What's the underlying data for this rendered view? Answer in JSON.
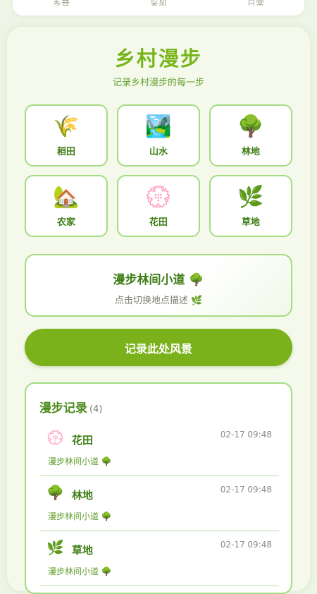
{
  "top_nav": {
    "items": [
      "乡音",
      "采风",
      "日常"
    ]
  },
  "header": {
    "title": "乡村漫步",
    "subtitle": "记录乡村漫步的每一步"
  },
  "places": [
    {
      "label": "稻田",
      "icon": "🌾",
      "icon_name": "rice-icon"
    },
    {
      "label": "山水",
      "icon": "🏞️",
      "icon_name": "landscape-icon"
    },
    {
      "label": "林地",
      "icon": "🌳",
      "icon_name": "tree-icon"
    },
    {
      "label": "农家",
      "icon": "🏡",
      "icon_name": "house-icon"
    },
    {
      "label": "花田",
      "icon": "💮",
      "icon_name": "flower-icon"
    },
    {
      "label": "草地",
      "icon": "🌿",
      "icon_name": "herb-icon"
    }
  ],
  "description": {
    "title": "漫步林间小道 🌳",
    "hint": "点击切换地点描述 🌿"
  },
  "record_button": {
    "label": "记录此处风景"
  },
  "log": {
    "title": "漫步记录",
    "count": "(4)",
    "entries": [
      {
        "icon": "💮",
        "name": "花田",
        "time": "02-17 09:48",
        "place": "漫步林间小道 🌳"
      },
      {
        "icon": "🌳",
        "name": "林地",
        "time": "02-17 09:48",
        "place": "漫步林间小道 🌳"
      },
      {
        "icon": "🌿",
        "name": "草地",
        "time": "02-17 09:48",
        "place": "漫步林间小道 🌳"
      }
    ]
  },
  "colors": {
    "accent": "#7bb11b",
    "title_green": "#78b51a",
    "border": "#a4dc82",
    "background": "#eef4e6"
  }
}
